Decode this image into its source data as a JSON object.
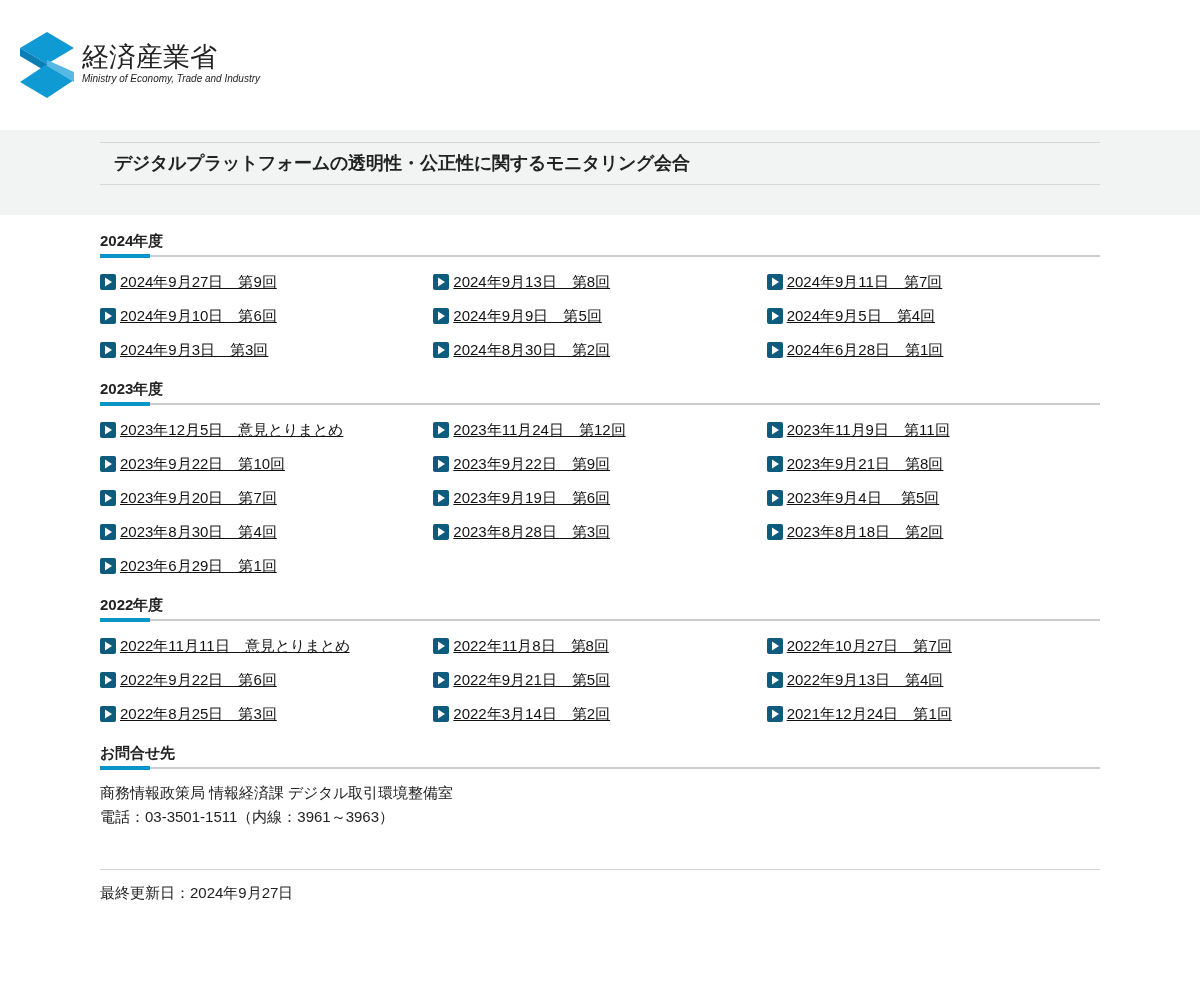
{
  "logo": {
    "name": "経済産業省",
    "subtitle": "Ministry of Economy, Trade and Industry"
  },
  "page_title": "デジタルプラットフォームの透明性・公正性に関するモニタリング会合",
  "sections": [
    {
      "heading": "2024年度",
      "links": [
        "2024年9月27日　第9回",
        "2024年9月13日　第8回",
        "2024年9月11日　第7回",
        "2024年9月10日　第6回",
        "2024年9月9日　第5回",
        "2024年9月5日　第4回",
        "2024年9月3日　第3回",
        "2024年8月30日　第2回",
        "2024年6月28日　第1回"
      ]
    },
    {
      "heading": "2023年度",
      "links": [
        "2023年12月5日　意見とりまとめ",
        "2023年11月24日　第12回",
        "2023年11月9日　第11回",
        "2023年9月22日　第10回",
        "2023年9月22日　第9回",
        "2023年9月21日　第8回",
        "2023年9月20日　第7回",
        "2023年9月19日　第6回",
        "2023年9月4日　 第5回",
        "2023年8月30日　第4回",
        "2023年8月28日　第3回",
        "2023年8月18日　第2回",
        "2023年6月29日　第1回"
      ]
    },
    {
      "heading": "2022年度",
      "links": [
        "2022年11月11日　意見とりまとめ",
        "2022年11月8日　第8回",
        "2022年10月27日　第7回",
        "2022年9月22日　第6回",
        "2022年9月21日　第5回",
        "2022年9月13日　第4回",
        "2022年8月25日　第3回",
        "2022年3月14日　第2回",
        "2021年12月24日　第1回"
      ]
    }
  ],
  "contact": {
    "heading": "お問合せ先",
    "lines": [
      "商務情報政策局 情報経済課 デジタル取引環境整備室",
      "電話：03-3501-1511（内線：3961～3963）"
    ]
  },
  "last_updated": "最終更新日：2024年9月27日"
}
